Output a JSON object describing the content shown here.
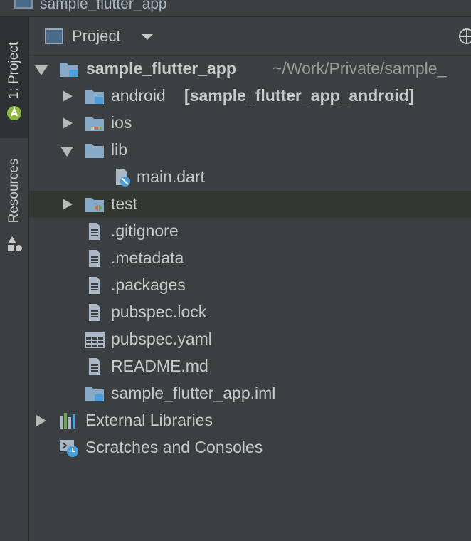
{
  "window": {
    "title": "sample_flutter_app"
  },
  "side_tabs": [
    {
      "label": "1: Project"
    },
    {
      "label": "Resources"
    }
  ],
  "header": {
    "title": "Project"
  },
  "tree": {
    "root": {
      "name": "sample_flutter_app",
      "path": "~/Work/Private/sample_"
    },
    "android": {
      "name": "android",
      "module": "[sample_flutter_app_android]"
    },
    "ios": {
      "name": "ios"
    },
    "lib": {
      "name": "lib"
    },
    "main_dart": {
      "name": "main.dart"
    },
    "test": {
      "name": "test"
    },
    "gitignore": {
      "name": ".gitignore"
    },
    "metadata": {
      "name": ".metadata"
    },
    "packages": {
      "name": ".packages"
    },
    "pubspec_lock": {
      "name": "pubspec.lock"
    },
    "pubspec_yaml": {
      "name": "pubspec.yaml"
    },
    "readme": {
      "name": "README.md"
    },
    "iml": {
      "name": "sample_flutter_app.iml"
    },
    "external_libraries": {
      "name": "External Libraries"
    },
    "scratches": {
      "name": "Scratches and Consoles"
    }
  },
  "colors": {
    "background": "#3c3f41",
    "folder": "#87aac9",
    "selected_row": "#32372f",
    "android_green": "#a4c639",
    "dart_blue": "#4a9fd8",
    "test_orange": "#e0673a",
    "test_green": "#6aa84f"
  },
  "icons": {
    "android-studio-icon": "android",
    "resources-icon": "shapes",
    "flutter-icon": "flutter"
  }
}
